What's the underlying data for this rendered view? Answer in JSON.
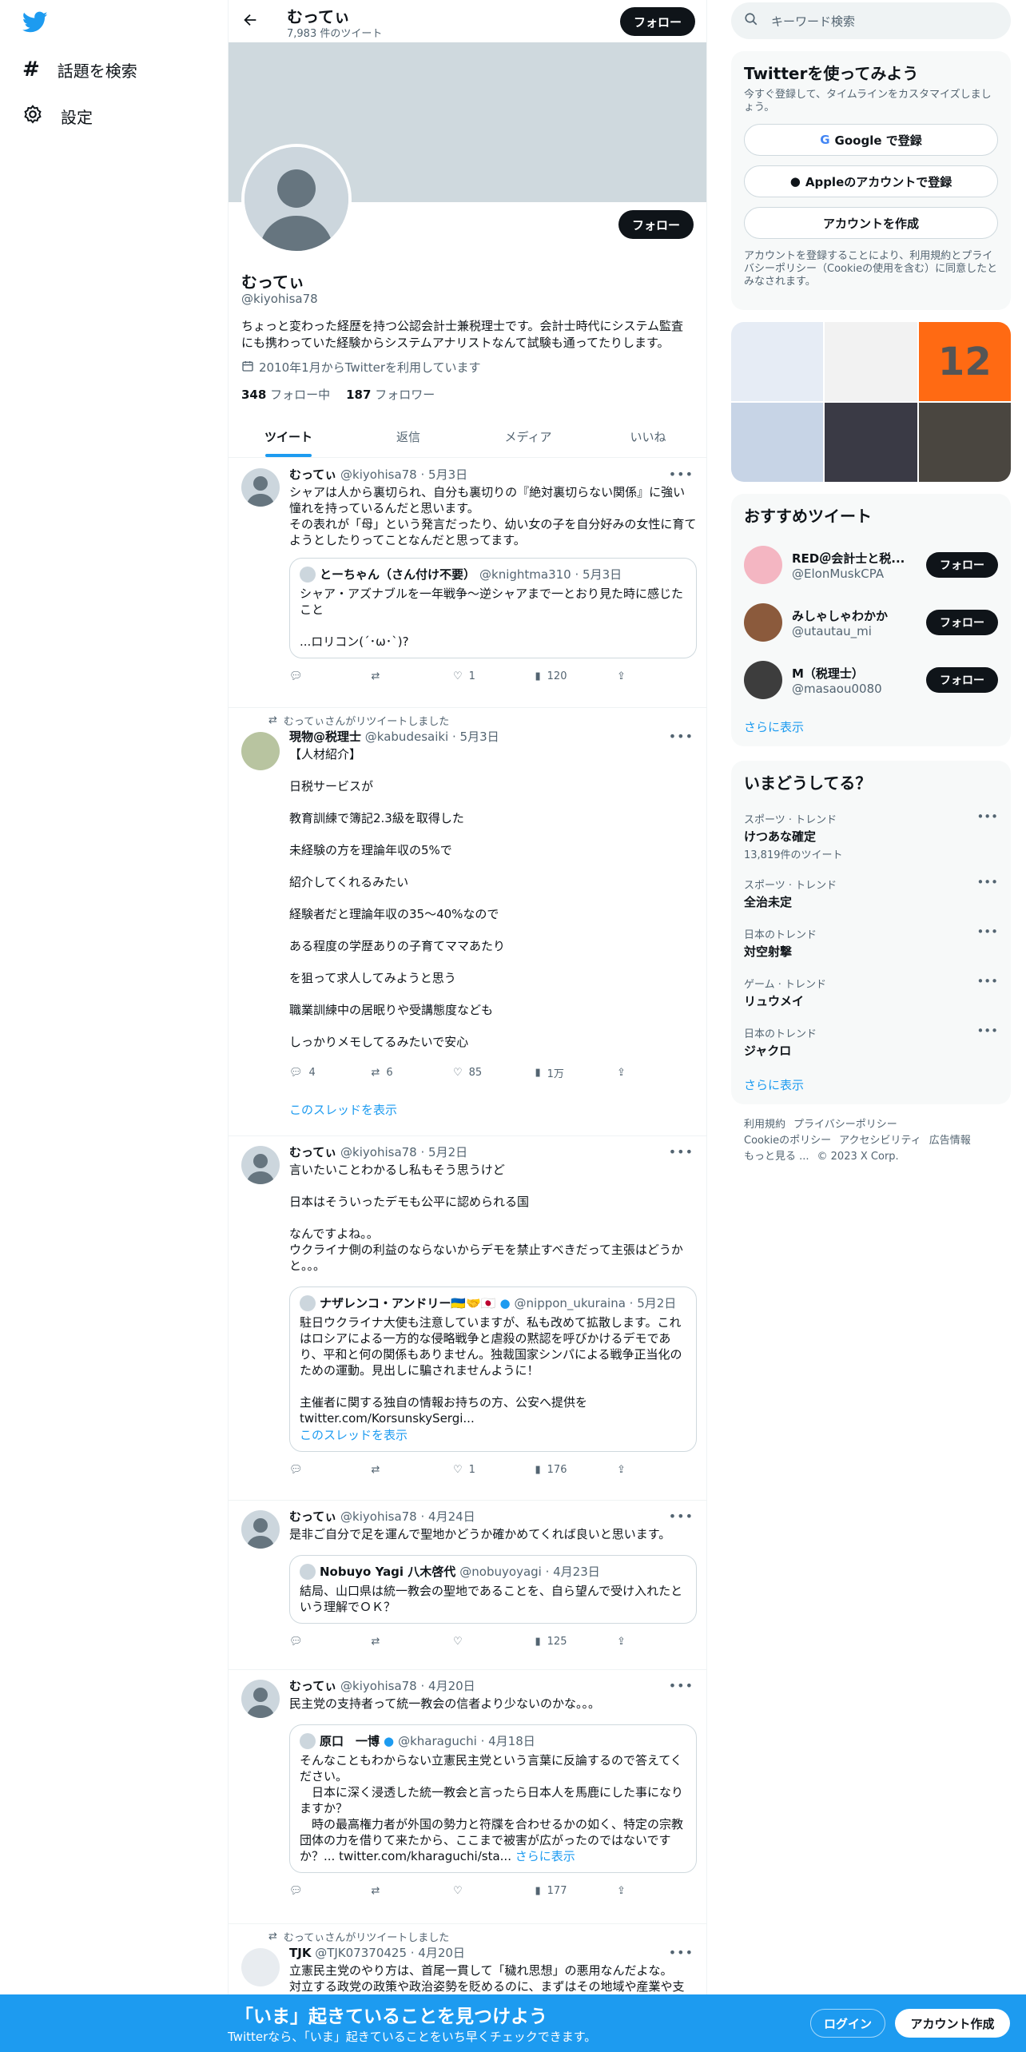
{
  "nav": {
    "explore": "話題を検索",
    "settings": "設定"
  },
  "topbar": {
    "name": "むってぃ",
    "tweet_count": "7,983 件のツイート",
    "follow": "フォロー"
  },
  "profile": {
    "name": "むってぃ",
    "handle": "@kiyohisa78",
    "bio": "ちょっと変わった経歴を持つ公認会計士兼税理士です。会計士時代にシステム監査にも携わっていた経験からシステムアナリストなんて試験も通ってたりします。",
    "joined": "2010年1月からTwitterを利用しています",
    "following_num": "348",
    "following_label": "フォロー中",
    "followers_num": "187",
    "followers_label": "フォロワー",
    "follow": "フォロー"
  },
  "tabs": [
    "ツイート",
    "返信",
    "メディア",
    "いいね"
  ],
  "tweets": [
    {
      "name": "むってぃ",
      "meta": "@kiyohisa78 · 5月3日",
      "text": "シャアは人から裏切られ、自分も裏切りの『絶対裏切らない関係』に強い憧れを持っているんだと思います。\nその表れが「母」という発言だったり、幼い女の子を自分好みの女性に育てようとしたりってことなんだと思ってます。",
      "quote": {
        "name": "とーちゃん（さん付け不要）",
        "meta": "@knightma310 · 5月3日",
        "text": "シャア・アズナブルを一年戦争～逆シャアまで一とおり見た時に感じたこと\n\n...ロリコン(´･ω･`)?"
      },
      "reply": "",
      "retweet": "",
      "like": "1",
      "views": "120"
    },
    {
      "retweet_label": "むってぃさんがリツイートしました",
      "name": "現物@税理士",
      "meta": "@kabudesaiki · 5月3日",
      "text": "【人材紹介】\n\n日税サービスが\n\n教育訓練で簿記2.3級を取得した\n\n未経験の方を理論年収の5%で\n\n紹介してくれるみたい\n\n経験者だと理論年収の35〜40%なので\n\nある程度の学歴ありの子育てママあたり\n\nを狙って求人してみようと思う\n\n職業訓練中の居眠りや受講態度なども\n\nしっかりメモしてるみたいで安心",
      "reply": "4",
      "retweet": "6",
      "like": "85",
      "views": "1万",
      "thread": "このスレッドを表示"
    },
    {
      "name": "むってぃ",
      "meta": "@kiyohisa78 · 5月2日",
      "text": "言いたいことわかるし私もそう思うけど\n\n日本はそういったデモも公平に認められる国\n\nなんですよね。。\nウクライナ側の利益のならないからデモを禁止すべきだって主張はどうかと。。。",
      "quote": {
        "name": "ナザレンコ・アンドリー🇺🇦🤝🇯🇵",
        "meta": "@nippon_ukuraina · 5月2日",
        "text": "駐日ウクライナ大使も注意していますが、私も改めて拡散します。これはロシアによる一方的な侵略戦争と虐殺の黙認を呼びかけるデモであり、平和と何の関係もありません。独裁国家シンパによる戦争正当化のための運動。見出しに騙されませんように！\n\n主催者に関する独自の情報お持ちの方、公安へ提供を\ntwitter.com/KorsunskySergi...",
        "thread": "このスレッドを表示"
      },
      "reply": "",
      "retweet": "",
      "like": "1",
      "views": "176"
    },
    {
      "name": "むってぃ",
      "meta": "@kiyohisa78 · 4月24日",
      "text": "是非ご自分で足を運んで聖地かどうか確かめてくれば良いと思います。",
      "quote": {
        "name": "Nobuyo Yagi 八木啓代",
        "meta": "@nobuyoyagi · 4月23日",
        "text": "結局、山口県は統一教会の聖地であることを、自ら望んで受け入れたという理解でＯＫ？"
      },
      "reply": "",
      "retweet": "",
      "like": "",
      "views": "125"
    },
    {
      "name": "むってぃ",
      "meta": "@kiyohisa78 · 4月20日",
      "text": "民主党の支持者って統一教会の信者より少ないのかな。。。",
      "quote": {
        "name": "原口　一博",
        "meta": "@kharaguchi · 4月18日",
        "text": "そんなこともわからない立憲民主党という言葉に反論するので答えてください。\n　日本に深く浸透した統一教会と言ったら日本人を馬鹿にした事になりますか？\n　時の最高権力者が外国の勢力と符牒を合わせるかの如く、特定の宗教団体の力を借りて来たから、ここまで被害が広がったのではないですか？... twitter.com/kharaguchi/sta...",
        "showmore": "さらに表示"
      },
      "reply": "",
      "retweet": "",
      "like": "",
      "views": "177"
    },
    {
      "retweet_label": "むってぃさんがリツイートしました",
      "name": "TJK",
      "meta": "@TJK07370425 · 4月20日",
      "text": "立憲民主党のやり方は、首尾一貫して「穢れ思想」の悪用なんだよな。\n対立する政党の政策や政治姿勢を貶めるのに、まずはその地域や産業や支"
    }
  ],
  "right": {
    "search_placeholder": "キーワード検索",
    "signup_title": "Twitterを使ってみよう",
    "signup_sub": "今すぐ登録して、タイムラインをカスタマイズしましょう。",
    "google": "Google で登録",
    "apple": "Appleのアカウントで登録",
    "create": "アカウントを作成",
    "terms": "アカウントを登録することにより、利用規約とプライバシーポリシー（Cookieの使用を含む）に同意したとみなされます。",
    "photo_number": "12",
    "rec_title": "おすすめツイート",
    "recs": [
      {
        "name": "RED＠会計士と税...",
        "handle": "@ElonMuskCPA"
      },
      {
        "name": "みしゃしゃわかか",
        "handle": "@utautau_mi"
      },
      {
        "name": "M（税理士）",
        "handle": "@masaou0080"
      }
    ],
    "rec_follow": "フォロー",
    "show_more": "さらに表示",
    "trend_title": "いまどうしてる？",
    "trends": [
      {
        "cat": "スポーツ · トレンド",
        "name": "けつあな確定",
        "count": "13,819件のツイート"
      },
      {
        "cat": "スポーツ · トレンド",
        "name": "全治未定",
        "count": ""
      },
      {
        "cat": "日本のトレンド",
        "name": "対空射撃",
        "count": ""
      },
      {
        "cat": "ゲーム · トレンド",
        "name": "リュウメイ",
        "count": ""
      },
      {
        "cat": "日本のトレンド",
        "name": "ジャクロ",
        "count": ""
      }
    ],
    "footer": [
      "利用規約",
      "プライバシーポリシー",
      "Cookieのポリシー",
      "アクセシビリティ",
      "広告情報",
      "もっと見る ...",
      "© 2023 X Corp."
    ]
  },
  "bottom": {
    "title": "「いま」起きていることを見つけよう",
    "sub": "Twitterなら、「いま」起きていることをいち早くチェックできます。",
    "login": "ログイン",
    "signup": "アカウント作成"
  },
  "colors": {
    "accent": "#1d9bf0",
    "banner": "#cfd9de",
    "black": "#0f1419"
  }
}
